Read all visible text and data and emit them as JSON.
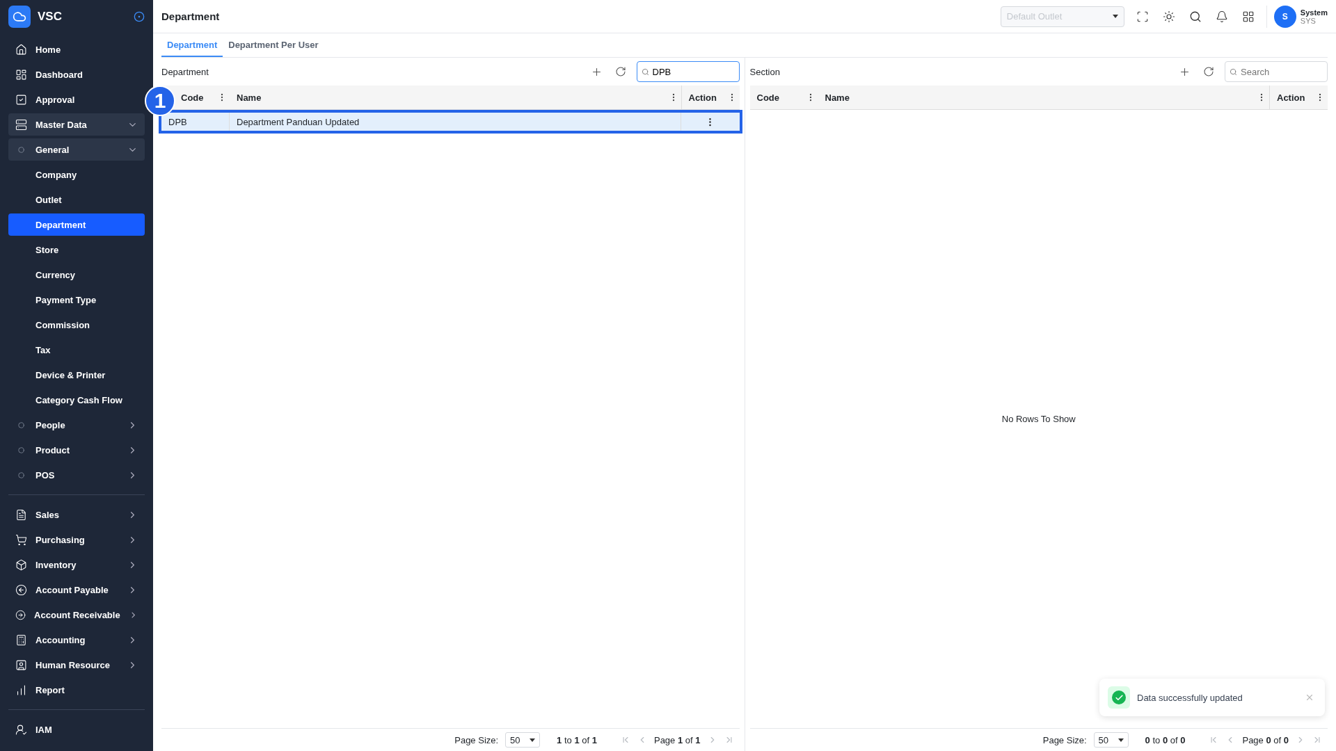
{
  "app": {
    "name": "VSC"
  },
  "sidebar": {
    "sections": [
      {
        "items": [
          {
            "label": "Home",
            "kind": "link",
            "selected": false
          },
          {
            "label": "Dashboard",
            "kind": "link",
            "selected": false
          },
          {
            "label": "Approval",
            "kind": "link",
            "selected": false
          },
          {
            "label": "Master Data",
            "kind": "group",
            "expanded": true,
            "children": [
              {
                "label": "General",
                "kind": "group",
                "expanded": true,
                "children": [
                  {
                    "label": "Company",
                    "kind": "link",
                    "selected": false
                  },
                  {
                    "label": "Outlet",
                    "kind": "link",
                    "selected": false
                  },
                  {
                    "label": "Department",
                    "kind": "link",
                    "selected": true
                  },
                  {
                    "label": "Store",
                    "kind": "link",
                    "selected": false
                  },
                  {
                    "label": "Currency",
                    "kind": "link",
                    "selected": false
                  },
                  {
                    "label": "Payment Type",
                    "kind": "link",
                    "selected": false
                  },
                  {
                    "label": "Commission",
                    "kind": "link",
                    "selected": false
                  },
                  {
                    "label": "Tax",
                    "kind": "link",
                    "selected": false
                  },
                  {
                    "label": "Device & Printer",
                    "kind": "link",
                    "selected": false
                  },
                  {
                    "label": "Category Cash Flow",
                    "kind": "link",
                    "selected": false
                  }
                ]
              },
              {
                "label": "People",
                "kind": "group",
                "expanded": false
              },
              {
                "label": "Product",
                "kind": "group",
                "expanded": false
              },
              {
                "label": "POS",
                "kind": "group",
                "expanded": false
              }
            ]
          }
        ]
      },
      {
        "items": [
          {
            "label": "Sales",
            "kind": "group",
            "expanded": false
          },
          {
            "label": "Purchasing",
            "kind": "group",
            "expanded": false
          },
          {
            "label": "Inventory",
            "kind": "group",
            "expanded": false
          },
          {
            "label": "Account Payable",
            "kind": "group",
            "expanded": false
          },
          {
            "label": "Account Receivable",
            "kind": "group",
            "expanded": false
          },
          {
            "label": "Accounting",
            "kind": "group",
            "expanded": false
          },
          {
            "label": "Human Resource",
            "kind": "group",
            "expanded": false
          },
          {
            "label": "Report",
            "kind": "link",
            "selected": false
          }
        ]
      },
      {
        "items": [
          {
            "label": "IAM",
            "kind": "link",
            "selected": false
          }
        ]
      }
    ]
  },
  "header": {
    "title": "Department",
    "outlet_select": {
      "placeholder": "Default Outlet"
    },
    "user": {
      "initial": "S",
      "name": "System",
      "code": "SYS"
    }
  },
  "tabs": [
    {
      "label": "Department",
      "selected": true
    },
    {
      "label": "Department Per User",
      "selected": false
    }
  ],
  "panels": [
    {
      "title": "Department",
      "search": {
        "value": "DPB",
        "focused": true
      },
      "columns": [
        "Code",
        "Name",
        "Action"
      ],
      "rows": [
        {
          "cells": [
            "DPB",
            "Department Panduan Updated"
          ],
          "selected": true,
          "callout": "1"
        }
      ],
      "footer": {
        "page_size_label": "Page Size:",
        "page_size": "50",
        "range": "**1** to **1** of **1**",
        "page": "Page **1** of **1**"
      }
    },
    {
      "title": "Section",
      "search": {
        "placeholder": "Search",
        "focused": false
      },
      "columns": [
        "Code",
        "Name",
        "Action"
      ],
      "empty_message": "No Rows To Show",
      "footer": {
        "page_size_label": "Page Size:",
        "page_size": "50",
        "range": "**0** to **0** of **0**",
        "page": "Page **0** of **0**"
      }
    }
  ],
  "toast": {
    "message": "Data successfully updated"
  }
}
